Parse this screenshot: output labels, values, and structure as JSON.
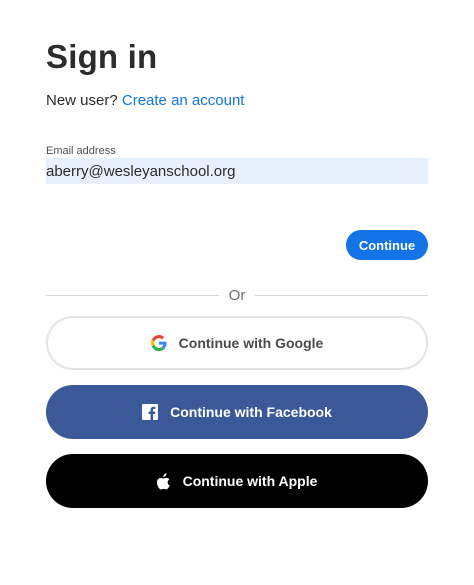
{
  "signin": {
    "title": "Sign in",
    "new_user_prompt": "New user?",
    "create_account_link": "Create an account",
    "email": {
      "label": "Email address",
      "value": "aberry@wesleyanschool.org"
    },
    "continue_label": "Continue",
    "divider_label": "Or",
    "social": {
      "google_label": "Continue with Google",
      "facebook_label": "Continue with Facebook",
      "apple_label": "Continue with Apple"
    }
  },
  "colors": {
    "accent": "#1473e6",
    "facebook": "#3b5998",
    "apple": "#000000",
    "input_bg": "#e8f0fe"
  },
  "icons": {
    "google": "google-logo-icon",
    "facebook": "facebook-logo-icon",
    "apple": "apple-logo-icon"
  }
}
